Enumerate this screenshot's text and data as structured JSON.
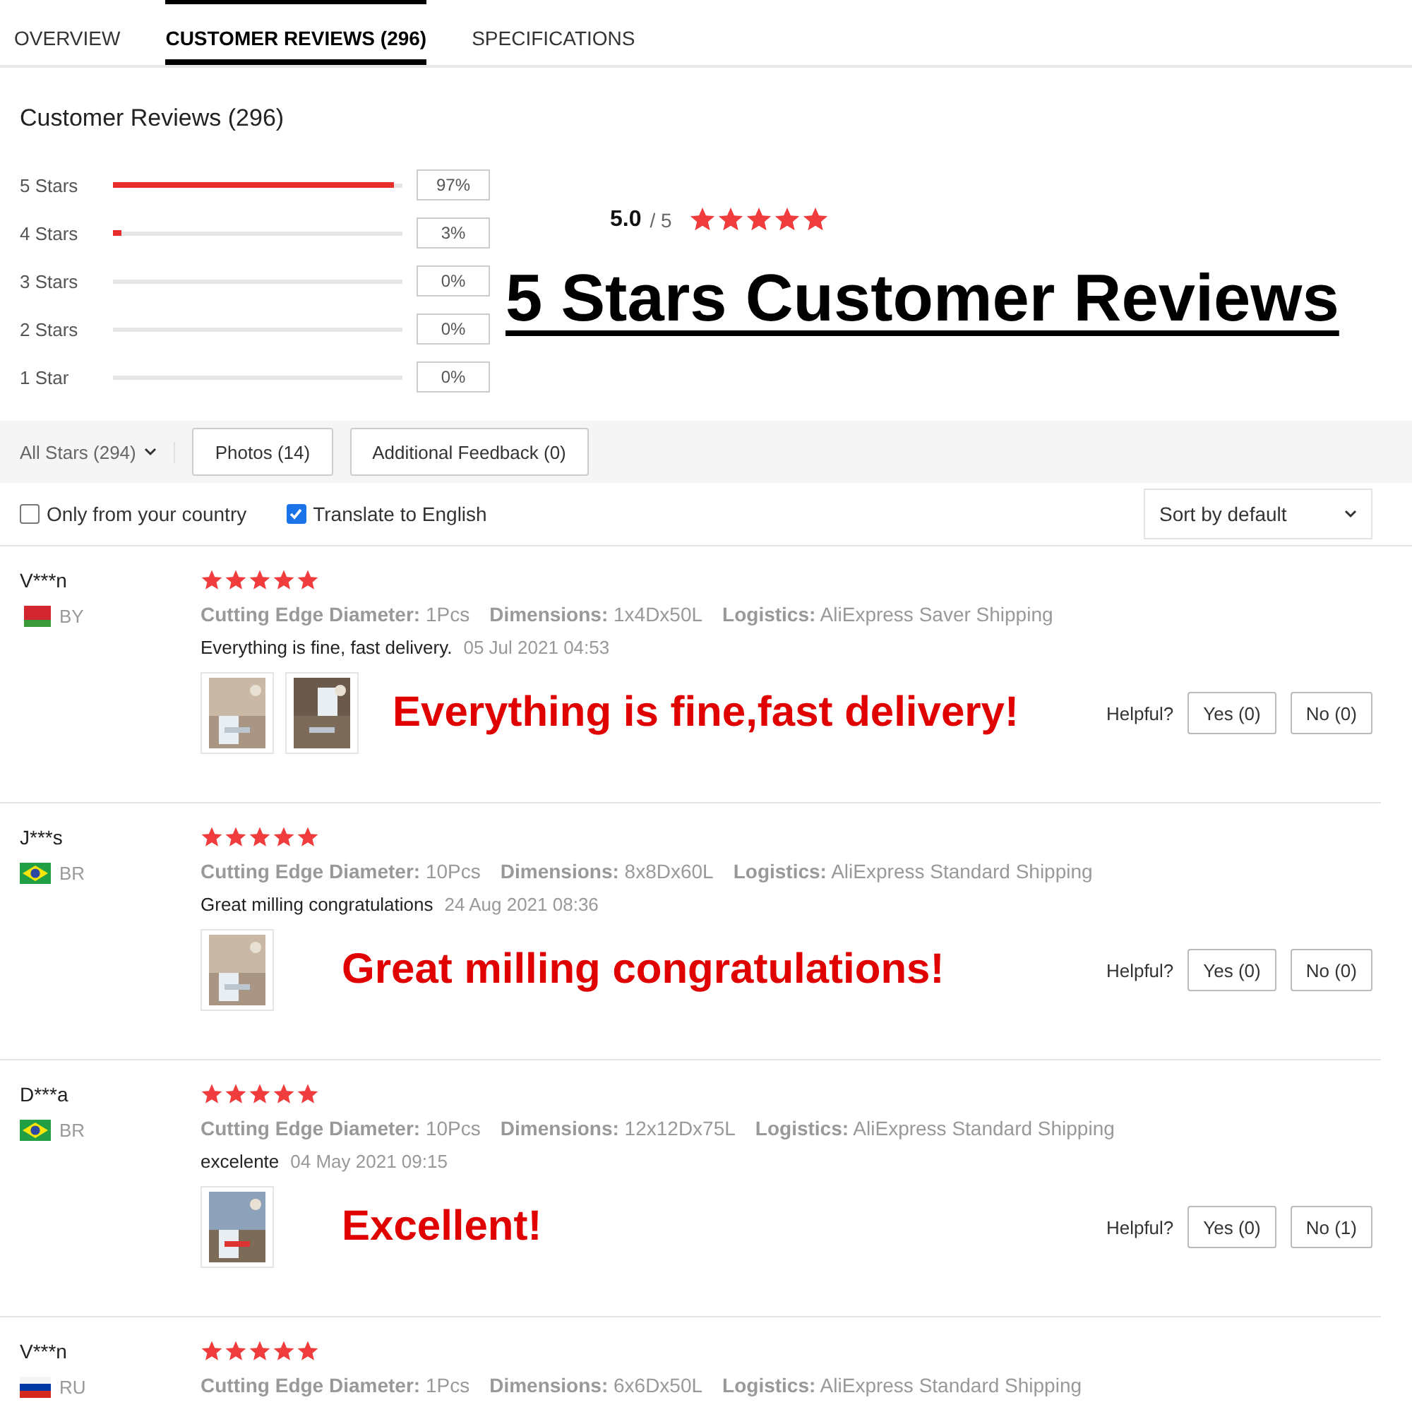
{
  "tabs": [
    {
      "label": "OVERVIEW",
      "selected": false
    },
    {
      "label": "CUSTOMER REVIEWS (296)",
      "selected": true
    },
    {
      "label": "SPECIFICATIONS",
      "selected": false
    }
  ],
  "summary": {
    "title": "Customer Reviews (296)",
    "bars": [
      {
        "label": "5 Stars",
        "level": 0.97,
        "percent": "97%"
      },
      {
        "label": "4 Stars",
        "level": 0.03,
        "percent": "3%"
      },
      {
        "label": "3 Stars",
        "percent": "0%"
      },
      {
        "label": "2 Stars",
        "percent": "0%"
      },
      {
        "label": "1 Star",
        "percent": "0%"
      }
    ],
    "score": "5.0",
    "score_max": "/ 5",
    "stars": 5,
    "headline": "5 Stars Customer Reviews"
  },
  "filters": {
    "star_filter": "All Stars (294)",
    "buttons": [
      "Photos (14)",
      "Additional Feedback (0)"
    ]
  },
  "options": {
    "checkboxes": [
      {
        "label": "Only from your country",
        "checked": false
      },
      {
        "label": "Translate to English",
        "checked": true
      }
    ],
    "sort": "Sort by default"
  },
  "reviews": [
    {
      "name": "V***n",
      "kind": "by",
      "country": "BY",
      "stars": 5,
      "attributes": [
        {
          "key": "Cutting Edge Diameter:",
          "value": "1Pcs"
        },
        {
          "key": "Dimensions:",
          "value": "1x4Dx50L"
        },
        {
          "key": "Logistics:",
          "value": "AliExpress Saver Shipping"
        }
      ],
      "text": "Everything is fine, fast delivery.",
      "date": "05 Jul 2021 04:53",
      "photos": [
        {
          "kind": "picture"
        },
        {
          "kind": "picture"
        }
      ],
      "caption": "Everything is fine,fast delivery!",
      "helpful_label": "Helpful?",
      "yes": "Yes (0)",
      "no": "No (0)"
    },
    {
      "name": "J***s",
      "kind": "br",
      "country": "BR",
      "stars": 5,
      "attributes": [
        {
          "key": "Cutting Edge Diameter:",
          "value": "10Pcs"
        },
        {
          "key": "Dimensions:",
          "value": "8x8Dx60L"
        },
        {
          "key": "Logistics:",
          "value": "AliExpress Standard Shipping"
        }
      ],
      "text": "Great milling congratulations",
      "date": "24 Aug 2021 08:36",
      "photos": [
        {
          "kind": "picture"
        }
      ],
      "caption": "Great milling congratulations!",
      "helpful_label": "Helpful?",
      "yes": "Yes (0)",
      "no": "No (0)"
    },
    {
      "name": "D***a",
      "kind": "br",
      "country": "BR",
      "stars": 5,
      "attributes": [
        {
          "key": "Cutting Edge Diameter:",
          "value": "10Pcs"
        },
        {
          "key": "Dimensions:",
          "value": "12x12Dx75L"
        },
        {
          "key": "Logistics:",
          "value": "AliExpress Standard Shipping"
        }
      ],
      "text": "excelente",
      "date": "04 May 2021 09:15",
      "photos": [
        {
          "kind": "picture"
        }
      ],
      "caption": "Excellent!",
      "helpful_label": "Helpful?",
      "yes": "Yes (0)",
      "no": "No (1)"
    },
    {
      "name": "V***n",
      "kind": "ru",
      "country": "RU",
      "stars": 5,
      "attributes": [
        {
          "key": "Cutting Edge Diameter:",
          "value": "1Pcs"
        },
        {
          "key": "Dimensions:",
          "value": "6x6Dx50L"
        },
        {
          "key": "Logistics:",
          "value": "AliExpress Standard Shipping"
        }
      ]
    }
  ]
}
